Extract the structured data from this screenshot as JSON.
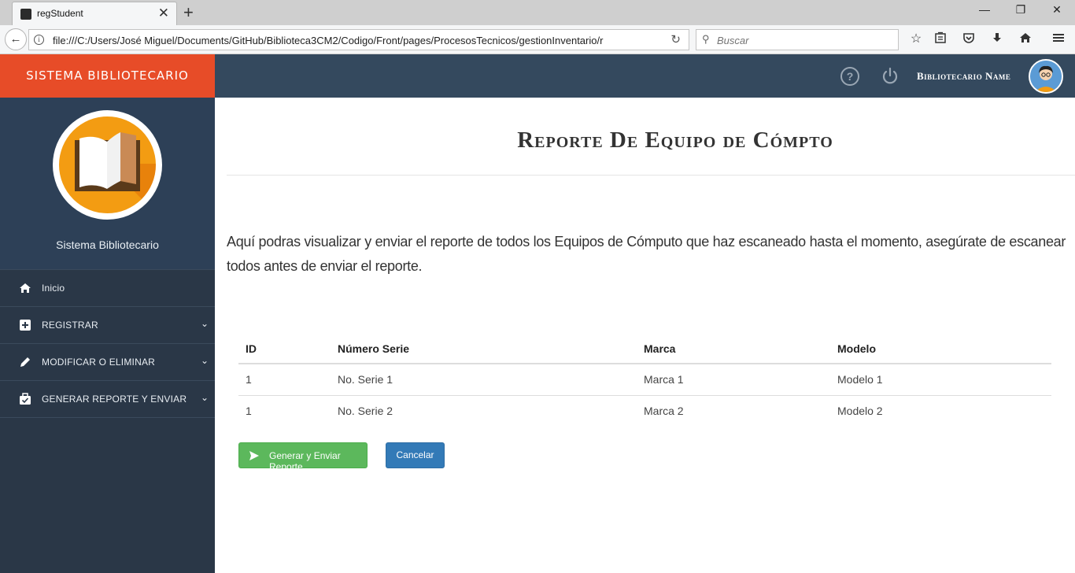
{
  "browser": {
    "tab_title": "regStudent",
    "url": "file:///C:/Users/José Miguel/Documents/GitHub/Biblioteca3CM2/Codigo/Front/pages/ProcesosTecnicos/gestionInventario/r",
    "search_placeholder": "Buscar"
  },
  "app": {
    "brand": "SISTEMA BIBLIOTECARIO",
    "user_name": "Bibliotecario Name",
    "site_name": "Sistema Bibliotecario",
    "brand_color": "#e74c28",
    "topbar_color": "#34495e",
    "sidebar_color": "#2a3747"
  },
  "sidebar": {
    "items": [
      {
        "label": "Inicio",
        "icon": "home-icon",
        "has_submenu": false
      },
      {
        "label": "REGISTRAR",
        "icon": "plus-square-icon",
        "has_submenu": true
      },
      {
        "label": "MODIFICAR O ELIMINAR",
        "icon": "pencil-icon",
        "has_submenu": true
      },
      {
        "label": "GENERAR REPORTE Y ENVIAR",
        "icon": "briefcase-check-icon",
        "has_submenu": true
      }
    ]
  },
  "main": {
    "title": "Reporte De Equipo de Cómpto",
    "description": "Aquí podras visualizar y enviar el reporte de todos los Equipos de Cómputo que haz escaneado hasta el momento, asegúrate de escanear todos antes de enviar el reporte.",
    "table": {
      "headers": [
        "ID",
        "Número Serie",
        "Marca",
        "Modelo"
      ],
      "rows": [
        [
          "1",
          "No. Serie 1",
          "Marca 1",
          "Modelo 1"
        ],
        [
          "1",
          "No. Serie 2",
          "Marca 2",
          "Modelo 2"
        ]
      ]
    },
    "send_button": "Generar y Enviar Reporte",
    "cancel_button": "Cancelar",
    "send_color": "#5cb85c",
    "cancel_color": "#337ab7"
  }
}
